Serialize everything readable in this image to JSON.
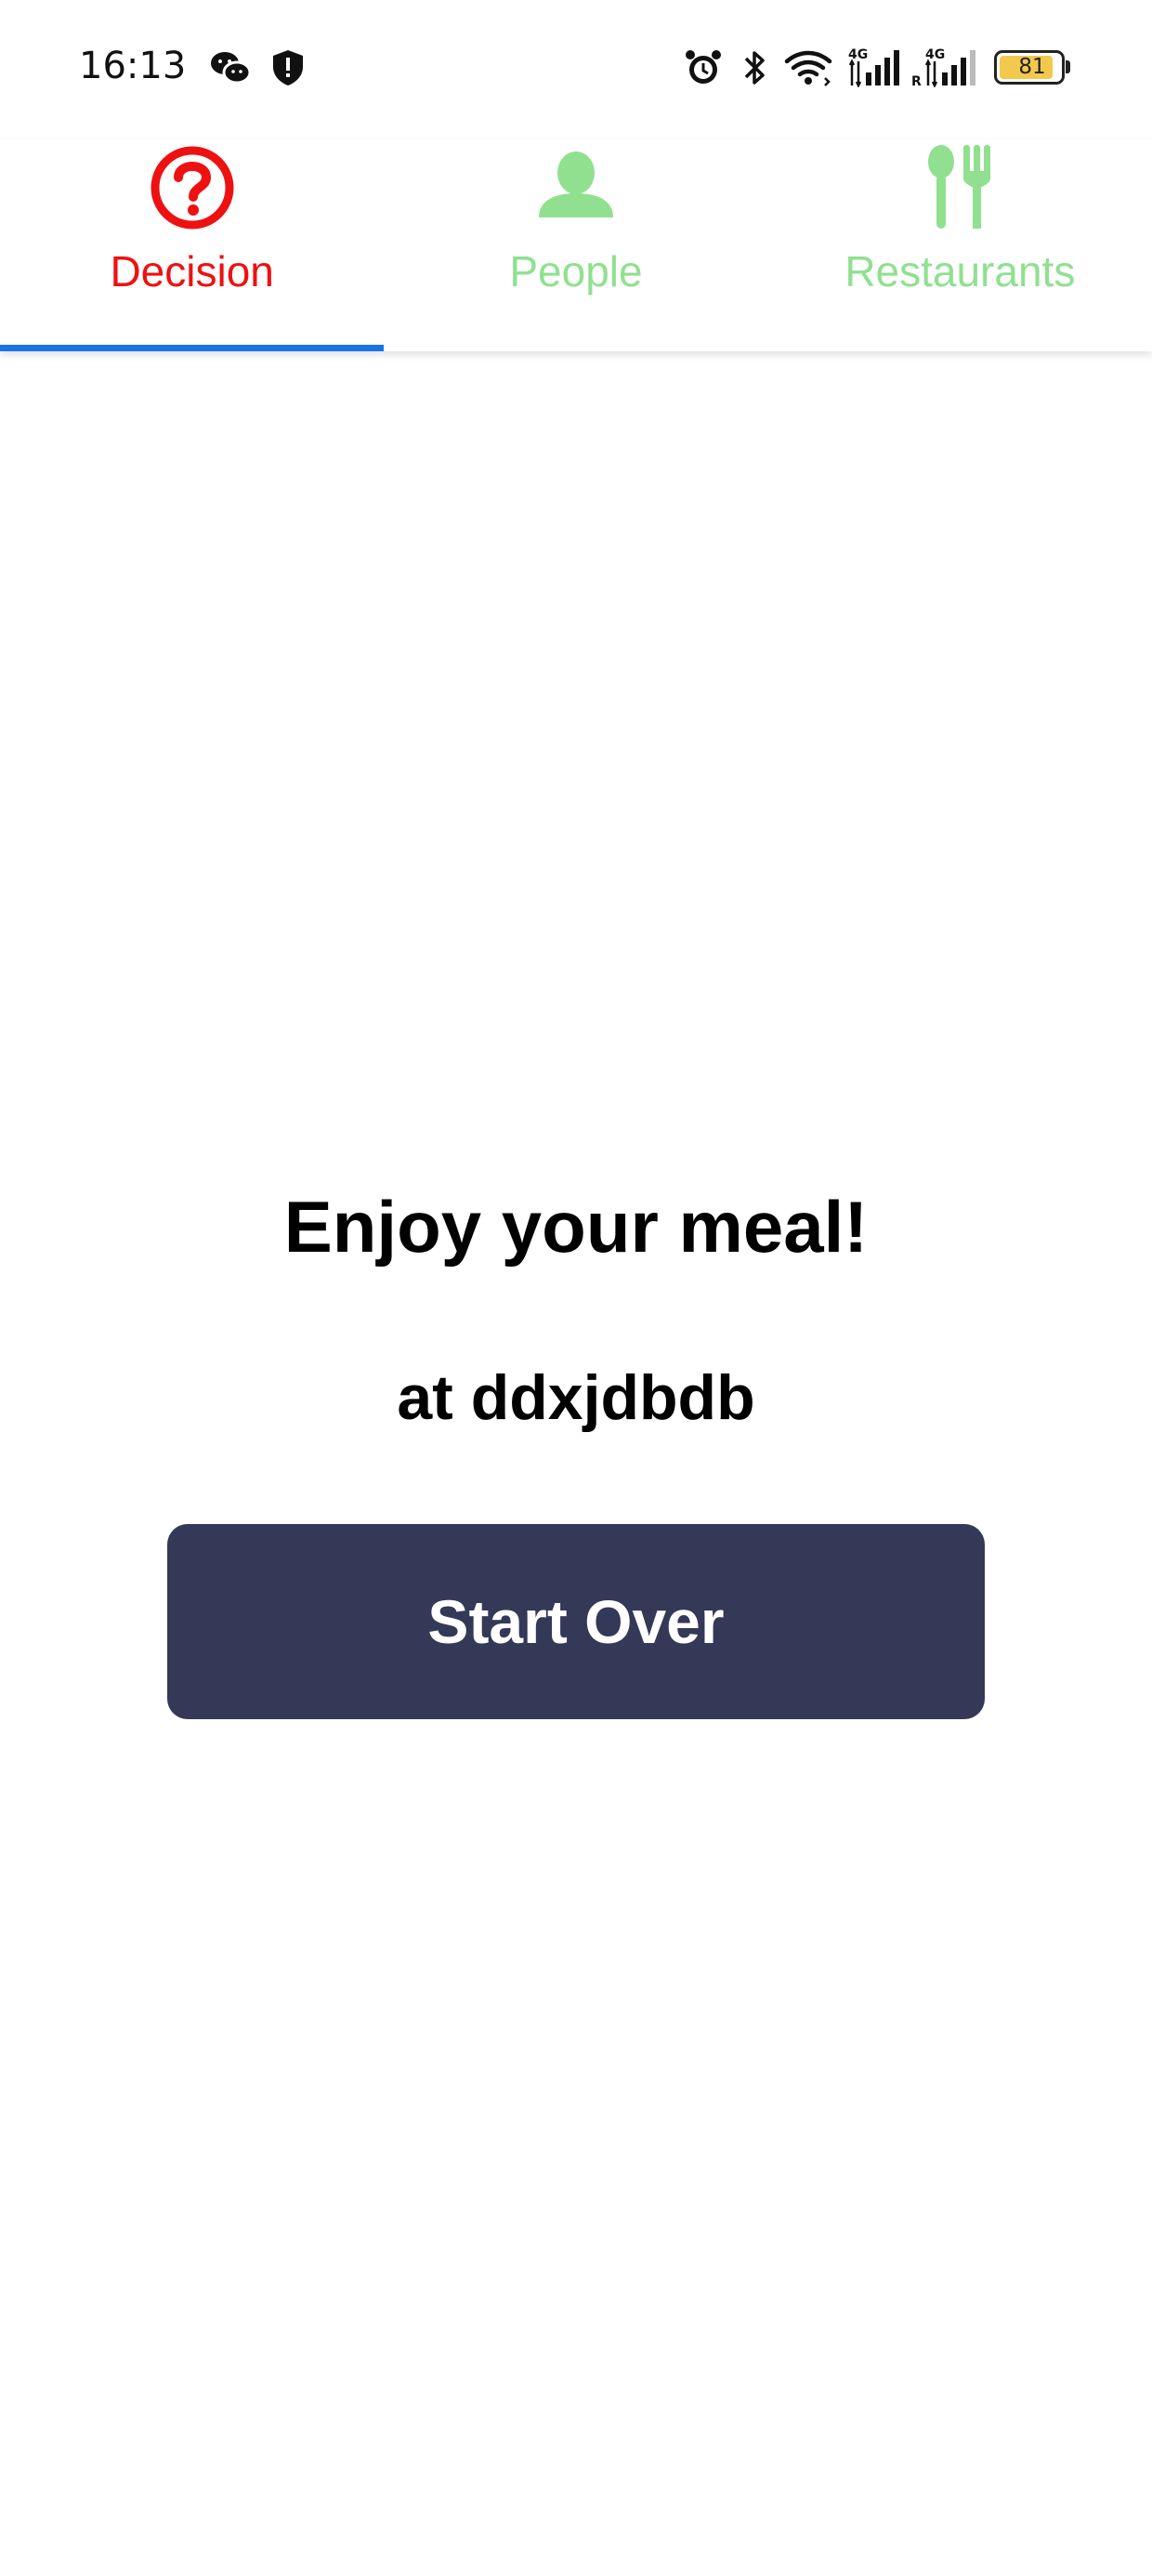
{
  "status_bar": {
    "time": "16:13",
    "battery_level": "81",
    "battery_fraction": 0.81,
    "icons": [
      "wechat-icon",
      "shield-icon",
      "alarm-icon",
      "bluetooth-icon",
      "wifi-icon",
      "signal-4g-icon",
      "signal-4g-roaming-icon",
      "battery-icon"
    ]
  },
  "tabs": [
    {
      "label": "Decision",
      "icon": "question-circle-icon",
      "active": true
    },
    {
      "label": "People",
      "icon": "person-icon",
      "active": false
    },
    {
      "label": "Restaurants",
      "icon": "utensils-icon",
      "active": false
    }
  ],
  "main": {
    "title": "Enjoy your meal!",
    "subtitle": "at ddxjdbdb",
    "start_over_label": "Start Over"
  },
  "colors": {
    "active_tab": "#ee1111",
    "inactive_tab": "#90e090",
    "indicator": "#1a73e8",
    "button_bg": "#333957",
    "button_text": "#ffffff"
  }
}
